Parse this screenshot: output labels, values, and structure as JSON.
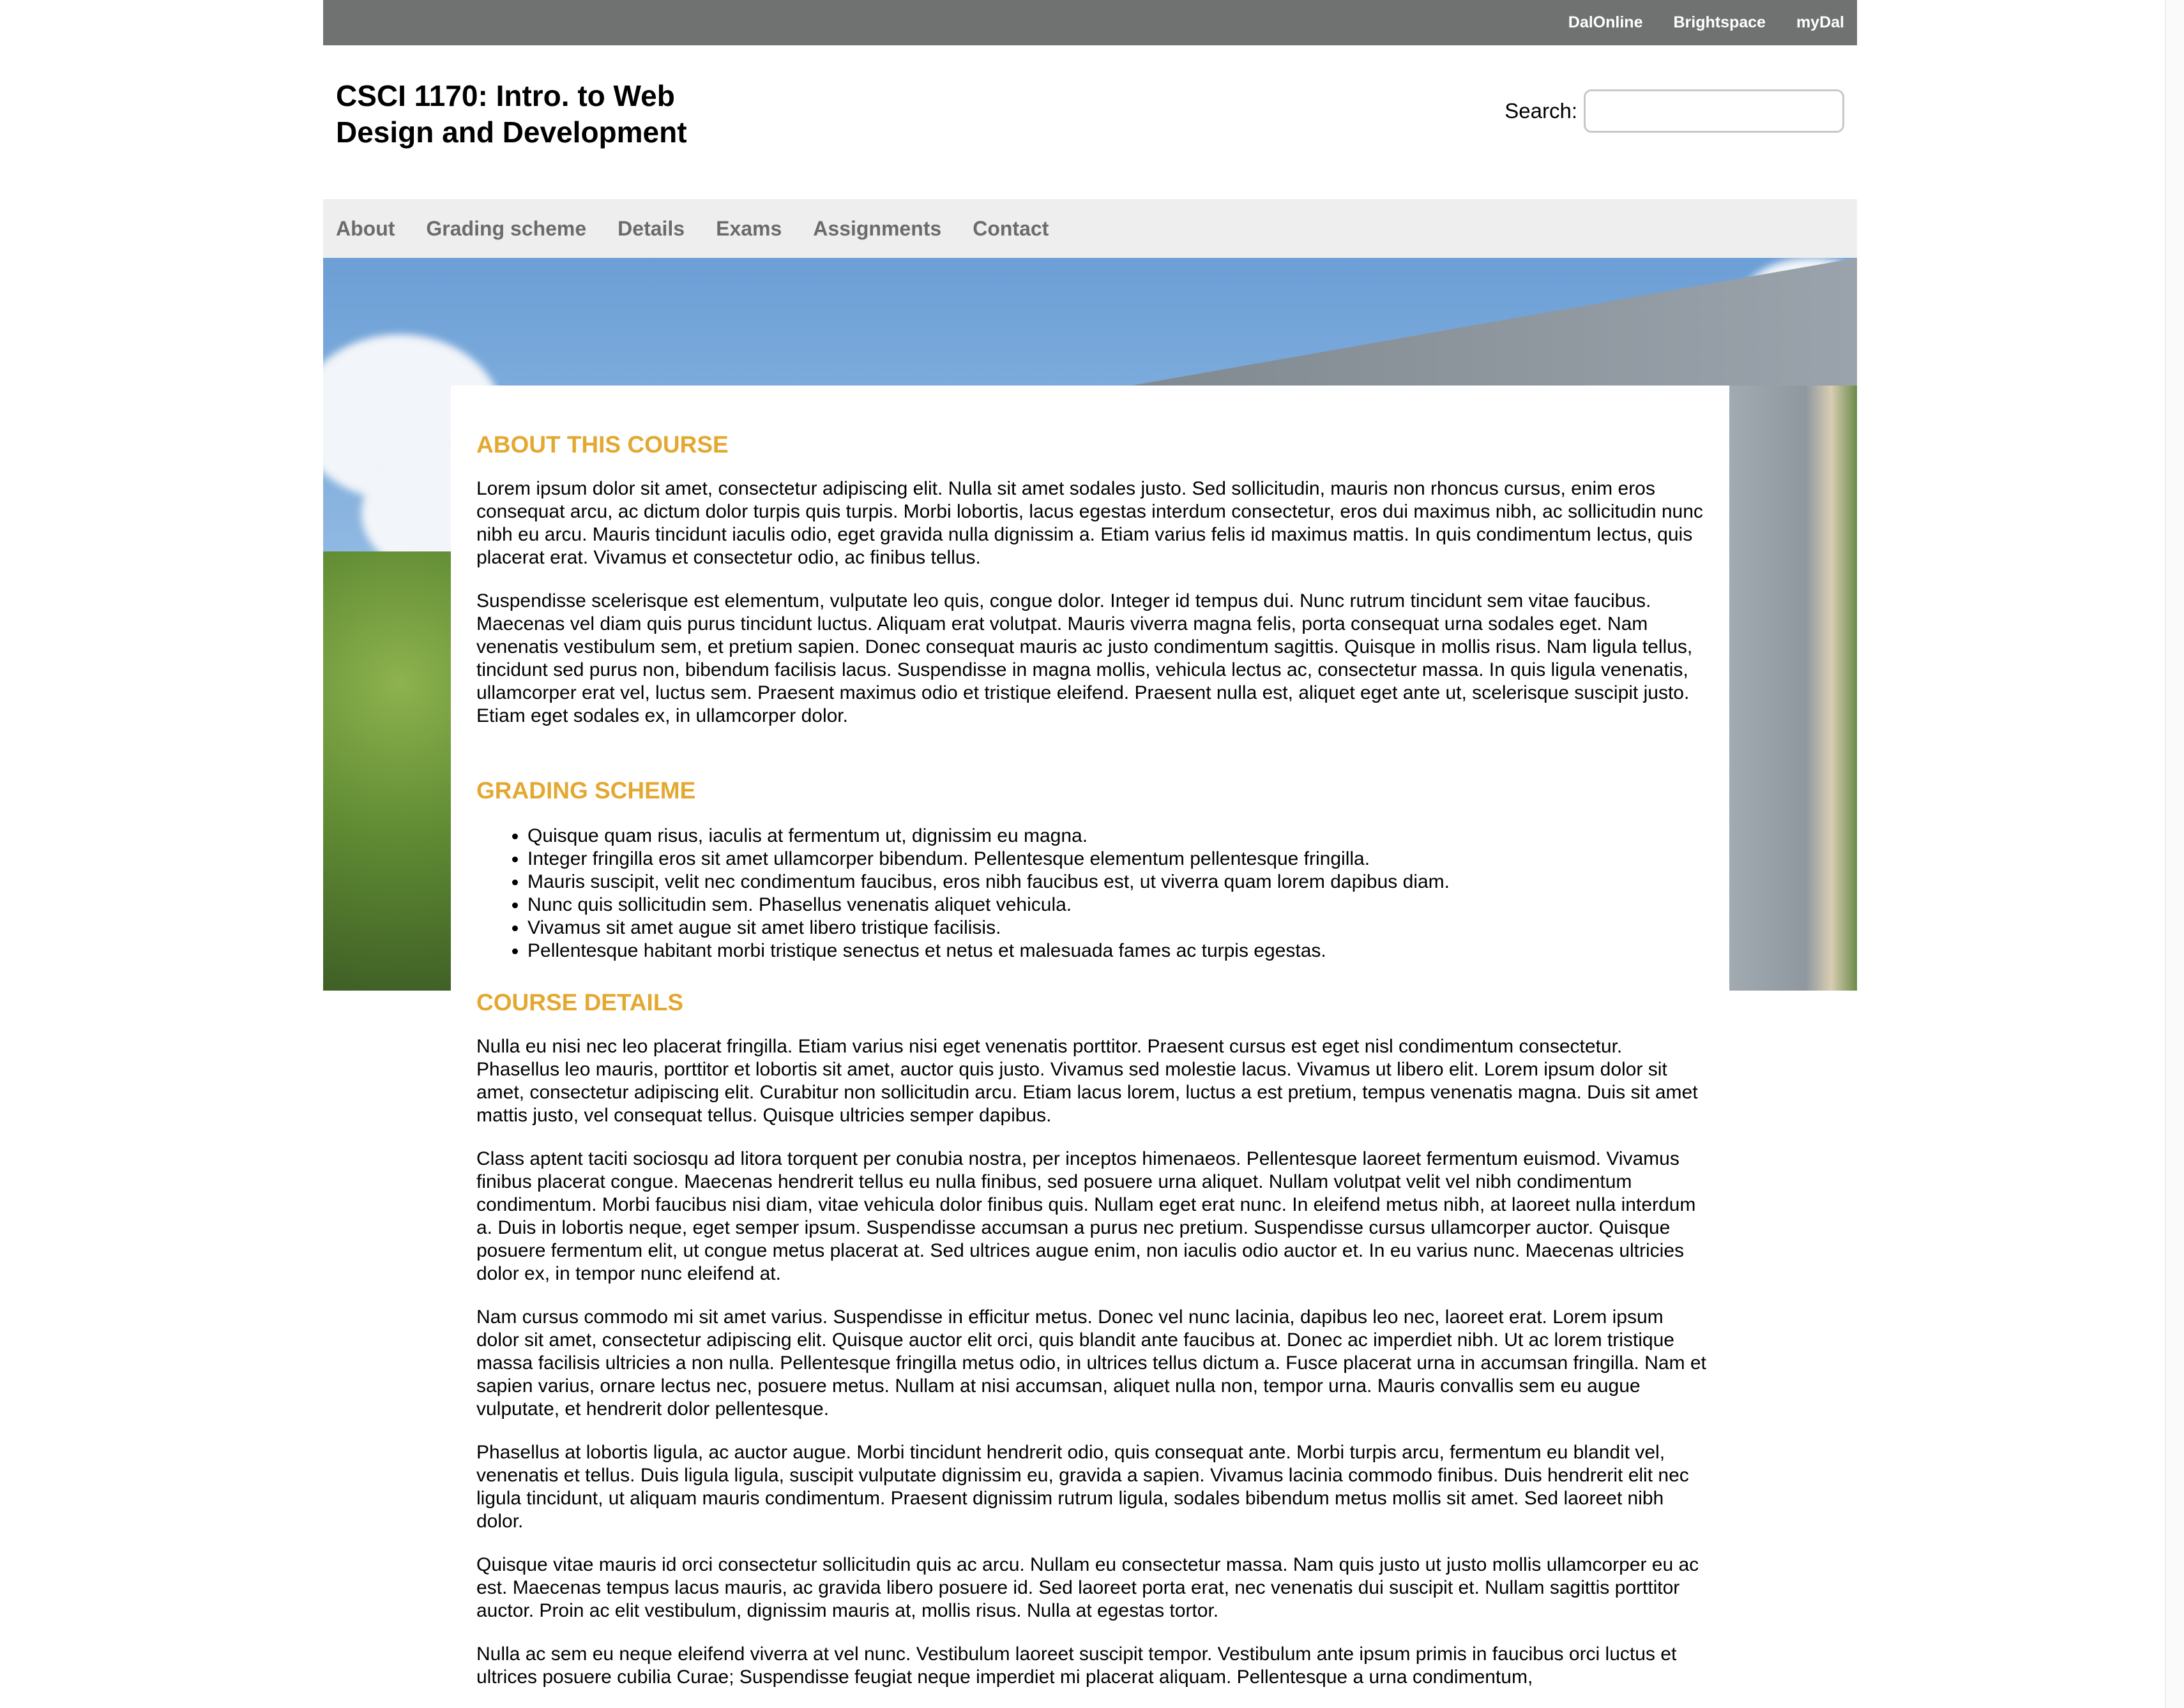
{
  "top_links": [
    "DalOnline",
    "Brightspace",
    "myDal"
  ],
  "site_title_line1": "CSCI 1170: Intro. to Web",
  "site_title_line2": "Design and Development",
  "search": {
    "label": "Search:",
    "value": ""
  },
  "nav": [
    "About",
    "Grading scheme",
    "Details",
    "Exams",
    "Assignments",
    "Contact"
  ],
  "about": {
    "heading": "ABOUT THIS COURSE",
    "p1": "Lorem ipsum dolor sit amet, consectetur adipiscing elit. Nulla sit amet sodales justo. Sed sollicitudin, mauris non rhoncus cursus, enim eros consequat arcu, ac dictum dolor turpis quis turpis. Morbi lobortis, lacus egestas interdum consectetur, eros dui maximus nibh, ac sollicitudin nunc nibh eu arcu. Mauris tincidunt iaculis odio, eget gravida nulla dignissim a. Etiam varius felis id maximus mattis. In quis condimentum lectus, quis placerat erat. Vivamus et consectetur odio, ac finibus tellus.",
    "p2": "Suspendisse scelerisque est elementum, vulputate leo quis, congue dolor. Integer id tempus dui. Nunc rutrum tincidunt sem vitae faucibus. Maecenas vel diam quis purus tincidunt luctus. Aliquam erat volutpat. Mauris viverra magna felis, porta consequat urna sodales eget. Nam venenatis vestibulum sem, et pretium sapien. Donec consequat mauris ac justo condimentum sagittis. Quisque in mollis risus. Nam ligula tellus, tincidunt sed purus non, bibendum facilisis lacus. Suspendisse in magna mollis, vehicula lectus ac, consectetur massa. In quis ligula venenatis, ullamcorper erat vel, luctus sem. Praesent maximus odio et tristique eleifend. Praesent nulla est, aliquet eget ante ut, scelerisque suscipit justo. Etiam eget sodales ex, in ullamcorper dolor."
  },
  "grading": {
    "heading": "GRADING SCHEME",
    "items": [
      "Quisque quam risus, iaculis at fermentum ut, dignissim eu magna.",
      "Integer fringilla eros sit amet ullamcorper bibendum. Pellentesque elementum pellentesque fringilla.",
      "Mauris suscipit, velit nec condimentum faucibus, eros nibh faucibus est, ut viverra quam lorem dapibus diam.",
      "Nunc quis sollicitudin sem. Phasellus venenatis aliquet vehicula.",
      "Vivamus sit amet augue sit amet libero tristique facilisis.",
      "Pellentesque habitant morbi tristique senectus et netus et malesuada fames ac turpis egestas."
    ]
  },
  "details": {
    "heading": "COURSE DETAILS",
    "paragraphs": [
      "Nulla eu nisi nec leo placerat fringilla. Etiam varius nisi eget venenatis porttitor. Praesent cursus est eget nisl condimentum consectetur. Phasellus leo mauris, porttitor et lobortis sit amet, auctor quis justo. Vivamus sed molestie lacus. Vivamus ut libero elit. Lorem ipsum dolor sit amet, consectetur adipiscing elit. Curabitur non sollicitudin arcu. Etiam lacus lorem, luctus a est pretium, tempus venenatis magna. Duis sit amet mattis justo, vel consequat tellus. Quisque ultricies semper dapibus.",
      "Class aptent taciti sociosqu ad litora torquent per conubia nostra, per inceptos himenaeos. Pellentesque laoreet fermentum euismod. Vivamus finibus placerat congue. Maecenas hendrerit tellus eu nulla finibus, sed posuere urna aliquet. Nullam volutpat velit vel nibh condimentum condimentum. Morbi faucibus nisi diam, vitae vehicula dolor finibus quis. Nullam eget erat nunc. In eleifend metus nibh, at laoreet nulla interdum a. Duis in lobortis neque, eget semper ipsum. Suspendisse accumsan a purus nec pretium. Suspendisse cursus ullamcorper auctor. Quisque posuere fermentum elit, ut congue metus placerat at. Sed ultrices augue enim, non iaculis odio auctor et. In eu varius nunc. Maecenas ultricies dolor ex, in tempor nunc eleifend at.",
      "Nam cursus commodo mi sit amet varius. Suspendisse in efficitur metus. Donec vel nunc lacinia, dapibus leo nec, laoreet erat. Lorem ipsum dolor sit amet, consectetur adipiscing elit. Quisque auctor elit orci, quis blandit ante faucibus at. Donec ac imperdiet nibh. Ut ac lorem tristique massa facilisis ultricies a non nulla. Pellentesque fringilla metus odio, in ultrices tellus dictum a. Fusce placerat urna in accumsan fringilla. Nam et sapien varius, ornare lectus nec, posuere metus. Nullam at nisi accumsan, aliquet nulla non, tempor urna. Mauris convallis sem eu augue vulputate, et hendrerit dolor pellentesque.",
      "Phasellus at lobortis ligula, ac auctor augue. Morbi tincidunt hendrerit odio, quis consequat ante. Morbi turpis arcu, fermentum eu blandit vel, venenatis et tellus. Duis ligula ligula, suscipit vulputate dignissim eu, gravida a sapien. Vivamus lacinia commodo finibus. Duis hendrerit elit nec ligula tincidunt, ut aliquam mauris condimentum. Praesent dignissim rutrum ligula, sodales bibendum metus mollis sit amet. Sed laoreet nibh dolor.",
      "Quisque vitae mauris id orci consectetur sollicitudin quis ac arcu. Nullam eu consectetur massa. Nam quis justo ut justo mollis ullamcorper eu ac est. Maecenas tempus lacus mauris, ac gravida libero posuere id. Sed laoreet porta erat, nec venenatis dui suscipit et. Nullam sagittis porttitor auctor. Proin ac elit vestibulum, dignissim mauris at, mollis risus. Nulla at egestas tortor.",
      "Nulla ac sem eu neque eleifend viverra at vel nunc. Vestibulum laoreet suscipit tempor. Vestibulum ante ipsum primis in faucibus orci luctus et ultrices posuere cubilia Curae; Suspendisse feugiat neque imperdiet mi placerat aliquam. Pellentesque a urna condimentum,"
    ]
  }
}
